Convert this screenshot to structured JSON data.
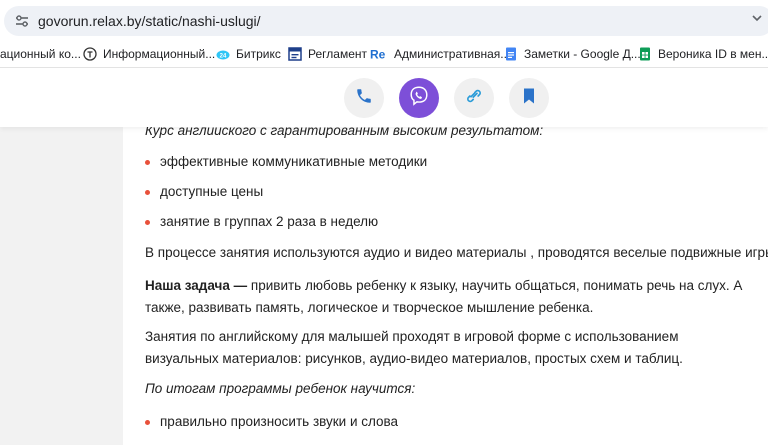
{
  "browser": {
    "url": "govorun.relax.by/static/nashi-uslugi/",
    "bookmarks": [
      {
        "label": "ационный ко...",
        "icon": "partial-site-icon"
      },
      {
        "label": "Информационный...",
        "icon": "t-circle-icon"
      },
      {
        "label": "Битрикс",
        "icon": "bitrix-cloud-icon"
      },
      {
        "label": "Регламент",
        "icon": "document-blue-icon"
      },
      {
        "label": "Административная...",
        "icon": "re-logo-icon"
      },
      {
        "label": "Заметки - Google Д...",
        "icon": "google-docs-icon"
      },
      {
        "label": "Вероника ID в мен...",
        "icon": "google-sheets-icon"
      }
    ]
  },
  "contact_bar": {
    "buttons": [
      {
        "icon": "phone-icon",
        "color": "#2b73c9"
      },
      {
        "icon": "viber-icon",
        "color": "#7d4fd8"
      },
      {
        "icon": "link-icon",
        "color": "#2b9cd8"
      },
      {
        "icon": "bookmark-icon",
        "color": "#2b73c9"
      }
    ]
  },
  "article": {
    "intro_italic": "Курс английского с гарантированным высоким результатом:",
    "features": [
      "эффективные коммуникативные методики",
      "доступные цены",
      "занятие в группах 2 раза в неделю"
    ],
    "para_materials": "В процессе занятия используются аудио и видео материалы , проводятся веселые подвижные игры.",
    "task_bold": "Наша задача —",
    "task_text": " привить любовь ребенку к языку, научить общаться, понимать речь на слух. А также, развивать память, логическое и творческое мышление ребенка.",
    "para_games": "Занятия по английскому для малышей проходят в игровой форме с использованием визуальных материалов: рисунков, аудио-видео материалов, простых схем и таблиц.",
    "results_italic": "По итогам программы ребенок научится:",
    "results": [
      "правильно произносить звуки и слова"
    ]
  },
  "colors": {
    "bullet": "#e8503a",
    "viber": "#7d4fd8"
  }
}
